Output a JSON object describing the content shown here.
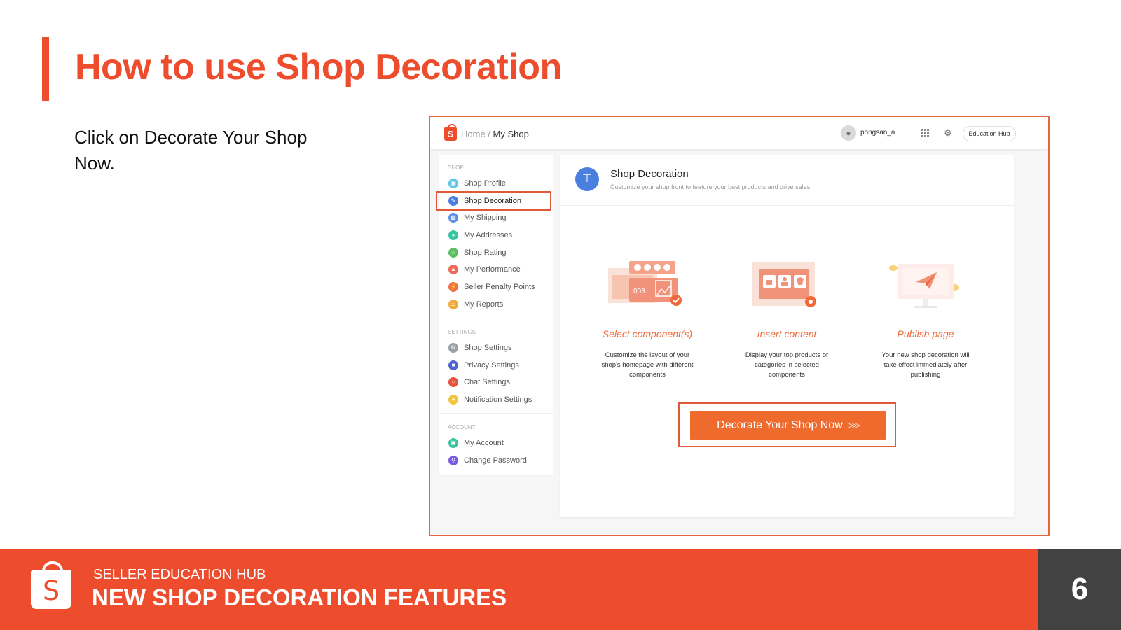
{
  "slide": {
    "title": "How to use Shop Decoration",
    "instruction": "Click on Decorate Your Shop Now."
  },
  "screenshot": {
    "topbar": {
      "logo_letter": "S",
      "breadcrumb_home": "Home",
      "breadcrumb_sep": " / ",
      "breadcrumb_current": "My Shop",
      "username": "pongsan_a",
      "education_hub": "Education Hub"
    },
    "sidebar": {
      "sections": [
        {
          "label": "SHOP",
          "items": [
            {
              "label": "Shop Profile",
              "color": "#5ec3e8"
            },
            {
              "label": "Shop Decoration",
              "color": "#4a7fe0",
              "active": true
            },
            {
              "label": "My Shipping",
              "color": "#5a8ee8"
            },
            {
              "label": "My Addresses",
              "color": "#3cc4a0"
            },
            {
              "label": "Shop Rating",
              "color": "#5cbf62"
            },
            {
              "label": "My Performance",
              "color": "#f06a5a"
            },
            {
              "label": "Seller Penalty Points",
              "color": "#f27048"
            },
            {
              "label": "My Reports",
              "color": "#f2a93b"
            }
          ]
        },
        {
          "label": "SETTINGS",
          "items": [
            {
              "label": "Shop Settings",
              "color": "#9aa0a6"
            },
            {
              "label": "Privacy Settings",
              "color": "#4f65c9"
            },
            {
              "label": "Chat Settings",
              "color": "#e8553f"
            },
            {
              "label": "Notification Settings",
              "color": "#f2c33b"
            }
          ]
        },
        {
          "label": "ACCOUNT",
          "items": [
            {
              "label": "My Account",
              "color": "#3cc4a0"
            },
            {
              "label": "Change Password",
              "color": "#7b5ce0"
            }
          ]
        }
      ]
    },
    "main": {
      "title": "Shop Decoration",
      "subtitle": "Customize your shop front to feature your best products and drive sales",
      "steps": [
        {
          "title": "Select component(s)",
          "desc": "Customize the layout of your shop's homepage with different components",
          "icon": "select-components-illustration"
        },
        {
          "title": "Insert content",
          "desc": "Display your top products or categories in selected components",
          "icon": "insert-content-illustration"
        },
        {
          "title": "Publish page",
          "desc": "Your new shop decoration will take effect immediately after publishing",
          "icon": "publish-page-illustration"
        }
      ],
      "illus_text": "003",
      "cta_label": "Decorate Your Shop Now",
      "cta_arrows": ">>>"
    }
  },
  "footer": {
    "logo_letter": "S",
    "subtitle": "SELLER EDUCATION HUB",
    "title": "NEW SHOP DECORATION FEATURES",
    "page_number": "6"
  },
  "colors": {
    "brand": "#ee4d2d",
    "cta": "#ee6a2d",
    "page_box": "#424242"
  }
}
